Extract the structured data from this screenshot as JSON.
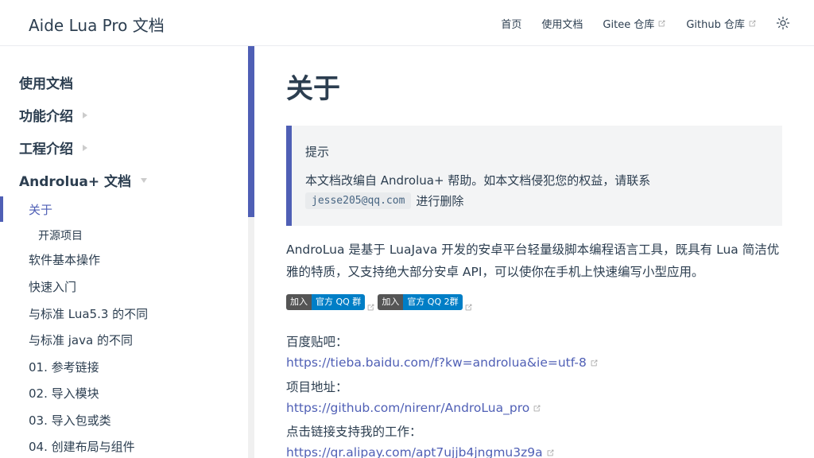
{
  "navbar": {
    "site_title": "Aide Lua Pro 文档",
    "links": [
      {
        "label": "首页",
        "external": false
      },
      {
        "label": "使用文档",
        "external": false
      },
      {
        "label": "Gitee 仓库",
        "external": true
      },
      {
        "label": "Github 仓库",
        "external": true
      }
    ],
    "theme_toggle_icon": "sun-icon"
  },
  "sidebar": {
    "groups": [
      {
        "label": "使用文档",
        "caret": "none"
      },
      {
        "label": "功能介绍",
        "caret": "right"
      },
      {
        "label": "工程介绍",
        "caret": "right"
      },
      {
        "label": "Androlua+ 文档",
        "caret": "down"
      }
    ],
    "items": [
      {
        "label": "关于",
        "active": true
      },
      {
        "label": "开源项目",
        "sub": true
      },
      {
        "label": "软件基本操作"
      },
      {
        "label": "快速入门"
      },
      {
        "label": "与标准 Lua5.3 的不同"
      },
      {
        "label": "与标准 java 的不同"
      },
      {
        "label": "01. 参考链接"
      },
      {
        "label": "02. 导入模块"
      },
      {
        "label": "03. 导入包或类"
      },
      {
        "label": "04. 创建布局与组件"
      }
    ]
  },
  "main": {
    "title": "关于",
    "tip": {
      "title": "提示",
      "line1": "本文档改编自 Androlua+ 帮助。如本文档侵犯您的权益，请联系",
      "code": "jesse205@qq.com",
      "line2_suffix": "进行删除"
    },
    "paragraph": "AndroLua 是基于 LuaJava 开发的安卓平台轻量级脚本编程语言工具，既具有 Lua 简洁优雅的特质，又支持绝大部分安卓 API，可以使你在手机上快速编写小型应用。",
    "badges": [
      {
        "left": "加入",
        "right": "官方 QQ 群"
      },
      {
        "left": "加入",
        "right": "官方 QQ 2群"
      }
    ],
    "sections": [
      {
        "label": "百度贴吧：",
        "link": "https://tieba.baidu.com/f?kw=androlua&ie=utf-8"
      },
      {
        "label": "项目地址：",
        "link": "https://github.com/nirenr/AndroLua_pro"
      },
      {
        "label": "点击链接支持我的工作：",
        "link": "https://qr.alipay.com/apt7ujjb4jngmu3z9a"
      }
    ]
  },
  "colors": {
    "accent": "#4f5fb5",
    "text": "#2c3e50",
    "tip_bg": "#f3f4f5",
    "badge_left": "#555555",
    "badge_right": "#007ec6"
  }
}
